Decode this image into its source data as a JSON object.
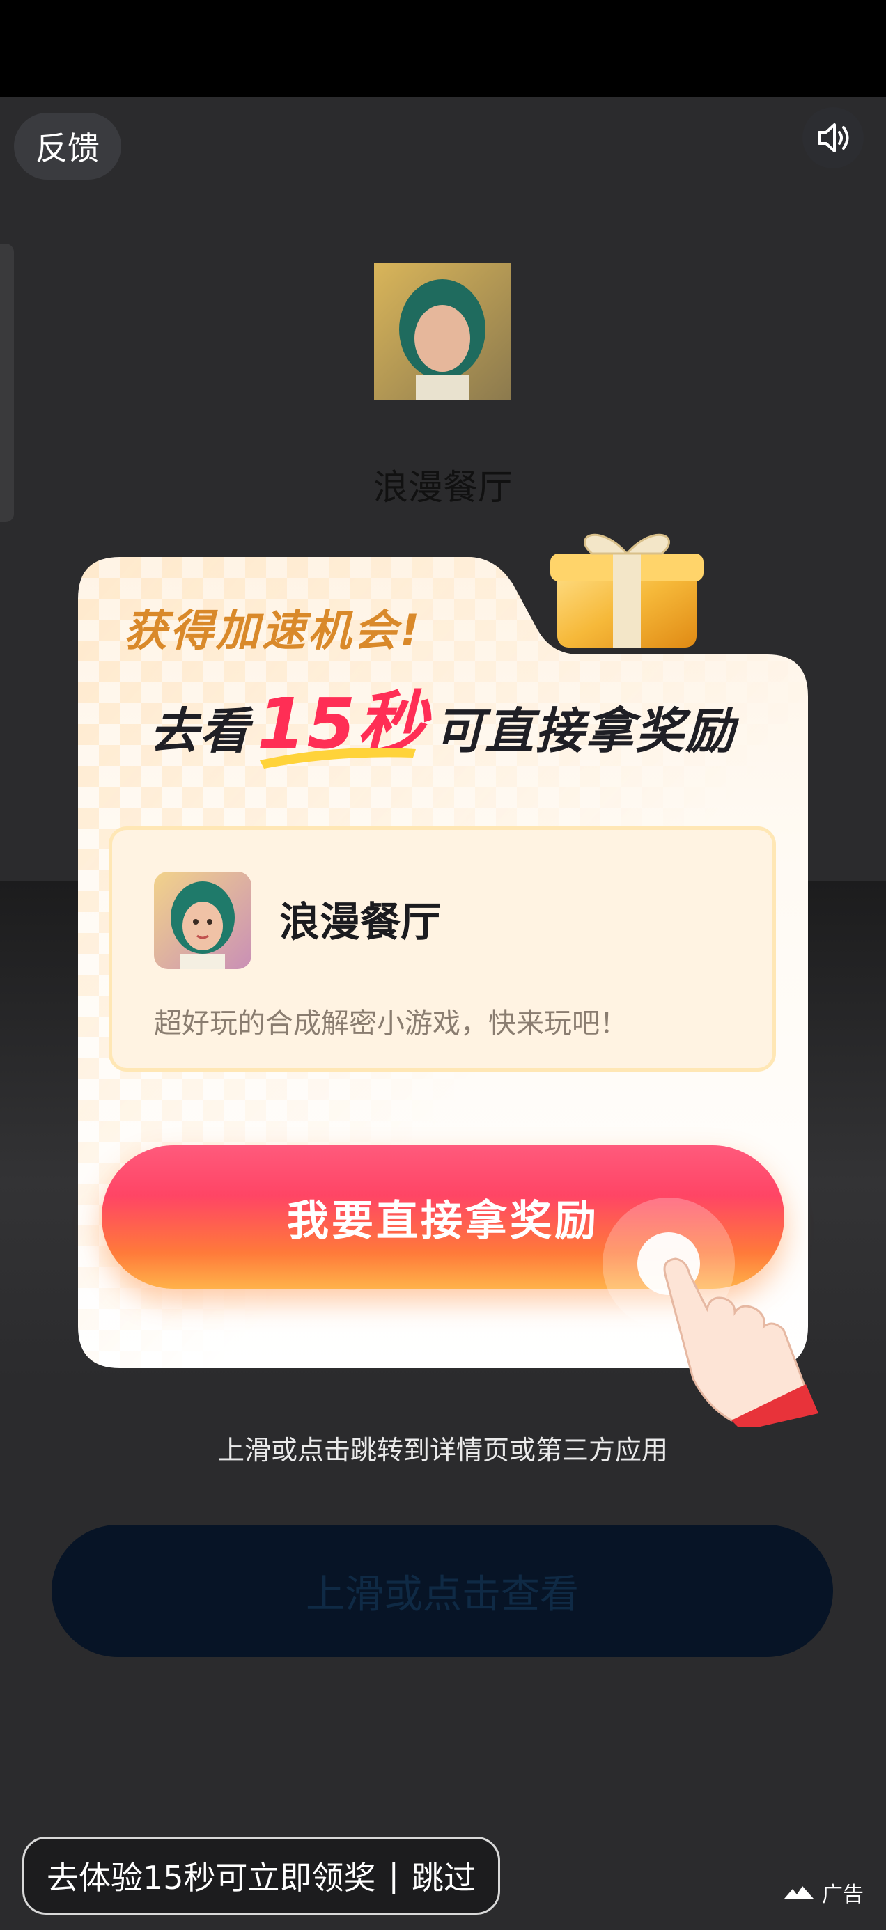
{
  "top_bar": {
    "feedback_label": "反馈",
    "sound_icon": "speaker-icon"
  },
  "background": {
    "app_name": "浪漫餐厅"
  },
  "modal": {
    "reward_title": "获得加速机会!",
    "headline_prefix": "去看",
    "headline_highlight": "15秒",
    "headline_suffix": "可直接拿奖励",
    "app_name": "浪漫餐厅",
    "app_description": "超好玩的合成解密小游戏，快来玩吧！",
    "cta_label": "我要直接拿奖励"
  },
  "jump_hint": "上滑或点击跳转到详情页或第三方应用",
  "ghost_button_label": "上滑或点击查看",
  "skip_bar": {
    "text": "去体验15秒可立即领奖",
    "separator": "|",
    "skip_label": "跳过"
  },
  "ad_label": "广告",
  "colors": {
    "accent": "#ff2e55",
    "title_gold": "#d9892a",
    "cta_start": "#ff4565",
    "cta_end": "#ffb24a"
  }
}
